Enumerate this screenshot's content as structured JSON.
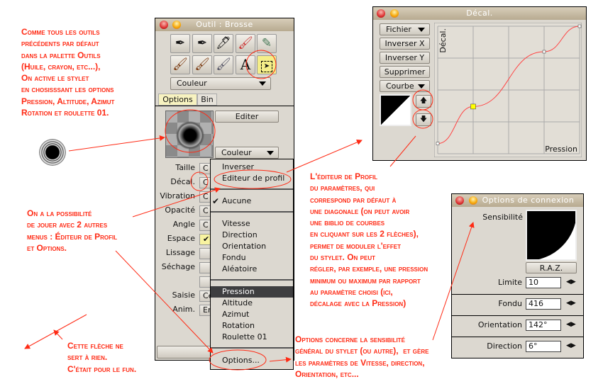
{
  "annotations": {
    "intro": "Comme tous les outils\nprécédents par défaut\ndans la palette Outils\n(Huile, crayon, etc...),\nOn active le stylet\nen chosisssant les options\nPression, Altitude, Azimut\nRotation et roulette 01.",
    "menus": "On a la possibilité\nde jouer avec 2 autres\nmenus : Éditeur de Profil\net Options.",
    "fun": "Cette flèche ne\nsert à rien.\nC'était pour le fun.",
    "profile": "L'éditeur de Profil\ndu paramètres, qui\ncorrespond par défaut à\nune diagonale (on peut avoir\nune biblio de courbes\nen cliquant sur les 2 flèches),\npermet de moduler l'effet\ndu stylet. On peut\nrégler, par exemple, une pression\nminimum ou maximum par rapport\nau paramètre choisi (ici,\ndécalage avec la Pression)",
    "options": "Options concerne la sensibilité\ngénéral du stylet (ou autre),  et gère\nles paramètres de Vitesse, direction,\nOrientation, etc..."
  },
  "tool_window": {
    "title": "Outil : Brosse",
    "color_select": "Couleur",
    "tabs": [
      "Options",
      "Bin"
    ],
    "edit_button": "Editer",
    "color_select2": "Couleur",
    "params": [
      {
        "label": "Taille",
        "value": "C"
      },
      {
        "label": "Décal.",
        "value": "C"
      },
      {
        "label": "Vibration",
        "value": "C"
      },
      {
        "label": "Opacité",
        "value": "C"
      },
      {
        "label": "Angle",
        "value": "C"
      },
      {
        "label": "Espace",
        "value": "✔"
      },
      {
        "label": "Lissage",
        "value": ""
      },
      {
        "label": "Séchage",
        "value": ""
      }
    ],
    "saisie_label": "Saisie",
    "saisie_value": "Ce",
    "anim_label": "Anim.",
    "anim_value": "En",
    "tools": [
      "brush-pen",
      "fountain-pen",
      "marker",
      "airbrush",
      "pencil",
      "flat-brush",
      "fan-brush",
      "knife",
      "text",
      "select"
    ]
  },
  "menu": {
    "items_top": [
      "Inverser",
      "Editeur de profil"
    ],
    "check": "✔",
    "none": "Aucune",
    "items_mid": [
      "Vitesse",
      "Direction",
      "Orientation",
      "Fondu",
      "Aléatoire"
    ],
    "items_stylus": [
      "Pression",
      "Altitude",
      "Azimut",
      "Rotation",
      "Roulette 01"
    ],
    "selected": "Pression",
    "options": "Options..."
  },
  "curve_window": {
    "title": "Décal.",
    "buttons": [
      "Fichier",
      "Inverser X",
      "Inverser Y",
      "Supprimer",
      "Courbe"
    ],
    "y_label": "Décal.",
    "x_label": "Pression",
    "up": "🡅",
    "down": "🡇",
    "curve_points": [
      [
        0,
        0.08
      ],
      [
        0.25,
        0.37
      ],
      [
        0.75,
        0.8
      ],
      [
        1,
        1
      ]
    ],
    "selected_point": 1
  },
  "options_window": {
    "title": "Options de connexion",
    "sensitivity_label": "Sensibilité",
    "reset": "R.A.Z.",
    "fields": [
      {
        "label": "Limite",
        "value": "10"
      },
      {
        "label": "Fondu",
        "value": "416"
      },
      {
        "label": "Orientation",
        "value": "142°"
      },
      {
        "label": "Direction",
        "value": "6°"
      }
    ]
  },
  "colors": {
    "annotation": "#ff2a14",
    "window": "#dcd8d0",
    "highlight": "#3e3e40",
    "selected_point": "#ffff00"
  }
}
